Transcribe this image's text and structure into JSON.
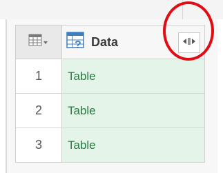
{
  "table": {
    "column_header": {
      "label": "Data",
      "type_icon": "table-query-icon"
    },
    "expand_button_icon": "expand-columns-icon",
    "corner_icon": "table-menu-icon",
    "rows": [
      {
        "number": "1",
        "value": "Table"
      },
      {
        "number": "2",
        "value": "Table"
      },
      {
        "number": "3",
        "value": "Table"
      }
    ]
  },
  "colors": {
    "cell_background": "#e5f4e8",
    "cell_text": "#1e7f3c",
    "highlight_circle": "#e10d14"
  }
}
